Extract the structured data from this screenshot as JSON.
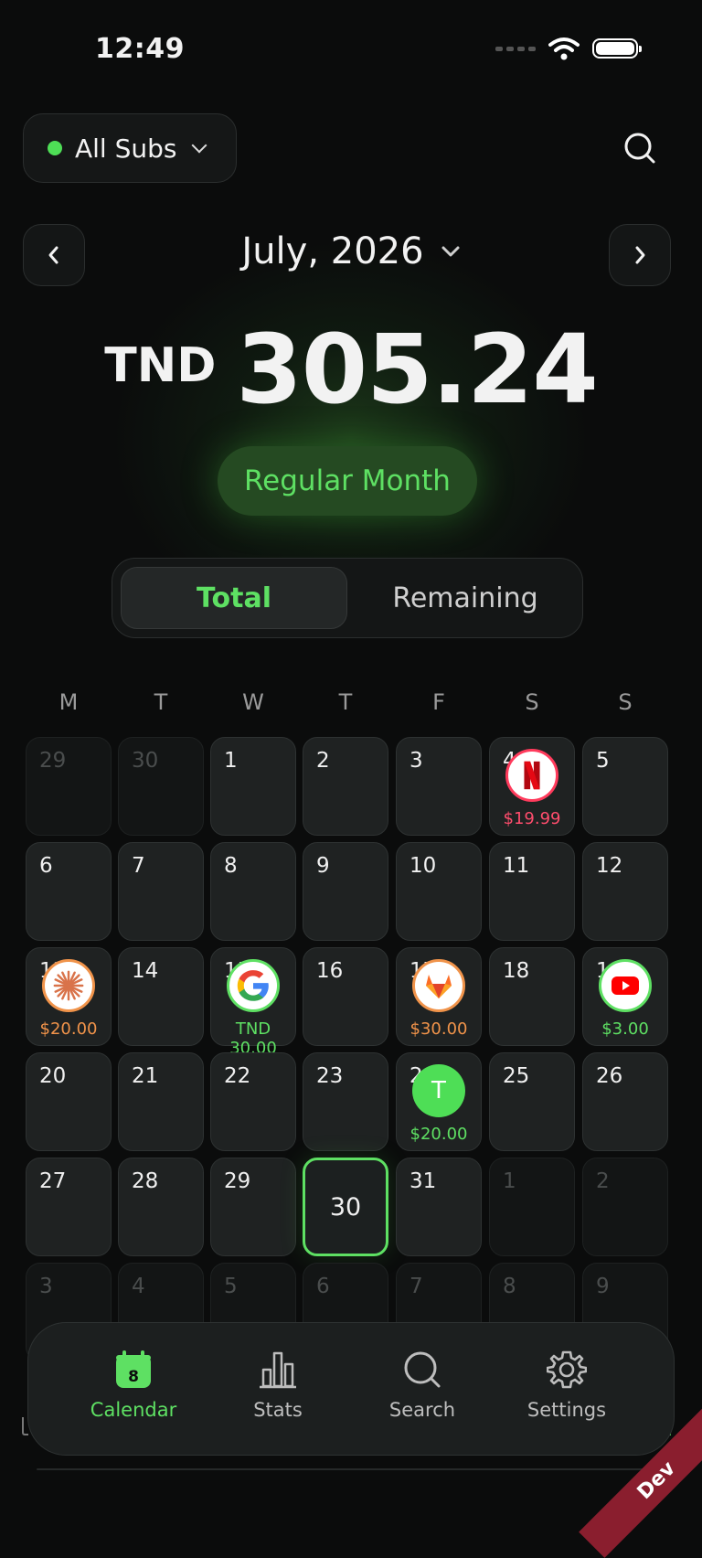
{
  "status_bar": {
    "time": "12:49"
  },
  "header": {
    "filter_label": "All Subs",
    "filter_dot_color": "#4ede56",
    "search_icon": "search-icon"
  },
  "month_nav": {
    "label": "July, 2026",
    "prev_icon": "chevron-left-icon",
    "next_icon": "chevron-right-icon"
  },
  "summary": {
    "currency": "TND",
    "amount": "305.24",
    "badge": "Regular Month"
  },
  "toggle": {
    "active": "Total",
    "other": "Remaining"
  },
  "calendar": {
    "weekdays": [
      "M",
      "T",
      "W",
      "T",
      "F",
      "S",
      "S"
    ],
    "rows": [
      [
        {
          "d": "29",
          "dim": true
        },
        {
          "d": "30",
          "dim": true
        },
        {
          "d": "1"
        },
        {
          "d": "2"
        },
        {
          "d": "3"
        },
        {
          "d": "4",
          "sub": "netflix",
          "price": "$19.99"
        },
        {
          "d": "5"
        }
      ],
      [
        {
          "d": "6"
        },
        {
          "d": "7"
        },
        {
          "d": "8"
        },
        {
          "d": "9"
        },
        {
          "d": "10"
        },
        {
          "d": "11"
        },
        {
          "d": "12"
        }
      ],
      [
        {
          "d": "13",
          "sub": "claude",
          "price": "$20.00"
        },
        {
          "d": "14"
        },
        {
          "d": "15",
          "sub": "google",
          "price": "TND 30.00"
        },
        {
          "d": "16"
        },
        {
          "d": "17",
          "sub": "gitlab",
          "price": "$30.00"
        },
        {
          "d": "18"
        },
        {
          "d": "19",
          "sub": "youtube",
          "price": "$3.00"
        }
      ],
      [
        {
          "d": "20"
        },
        {
          "d": "21"
        },
        {
          "d": "22"
        },
        {
          "d": "23"
        },
        {
          "d": "24",
          "sub": "letter",
          "letter": "T",
          "price": "$20.00"
        },
        {
          "d": "25"
        },
        {
          "d": "26"
        }
      ],
      [
        {
          "d": "27"
        },
        {
          "d": "28"
        },
        {
          "d": "29"
        },
        {
          "d": "30",
          "today": true
        },
        {
          "d": "31"
        },
        {
          "d": "1",
          "dim": true
        },
        {
          "d": "2",
          "dim": true
        }
      ],
      [
        {
          "d": "3",
          "dim": true
        },
        {
          "d": "4",
          "dim": true
        },
        {
          "d": "5",
          "dim": true
        },
        {
          "d": "6",
          "dim": true
        },
        {
          "d": "7",
          "dim": true
        },
        {
          "d": "8",
          "dim": true
        },
        {
          "d": "9",
          "dim": true
        }
      ]
    ],
    "price_colors": {
      "netflix": "#ff4d6d",
      "claude": "#f0934a",
      "google": "#5ee063",
      "gitlab": "#f0934a",
      "youtube": "#5ee063",
      "letter": "#5ee063"
    }
  },
  "bottom_nav": {
    "tabs": [
      {
        "label": "Calendar",
        "icon": "calendar-icon",
        "badge": "8",
        "active": true
      },
      {
        "label": "Stats",
        "icon": "bar-chart-icon"
      },
      {
        "label": "Search",
        "icon": "search-icon"
      },
      {
        "label": "Settings",
        "icon": "gear-icon"
      }
    ]
  },
  "ribbon": {
    "label": "Dev"
  }
}
